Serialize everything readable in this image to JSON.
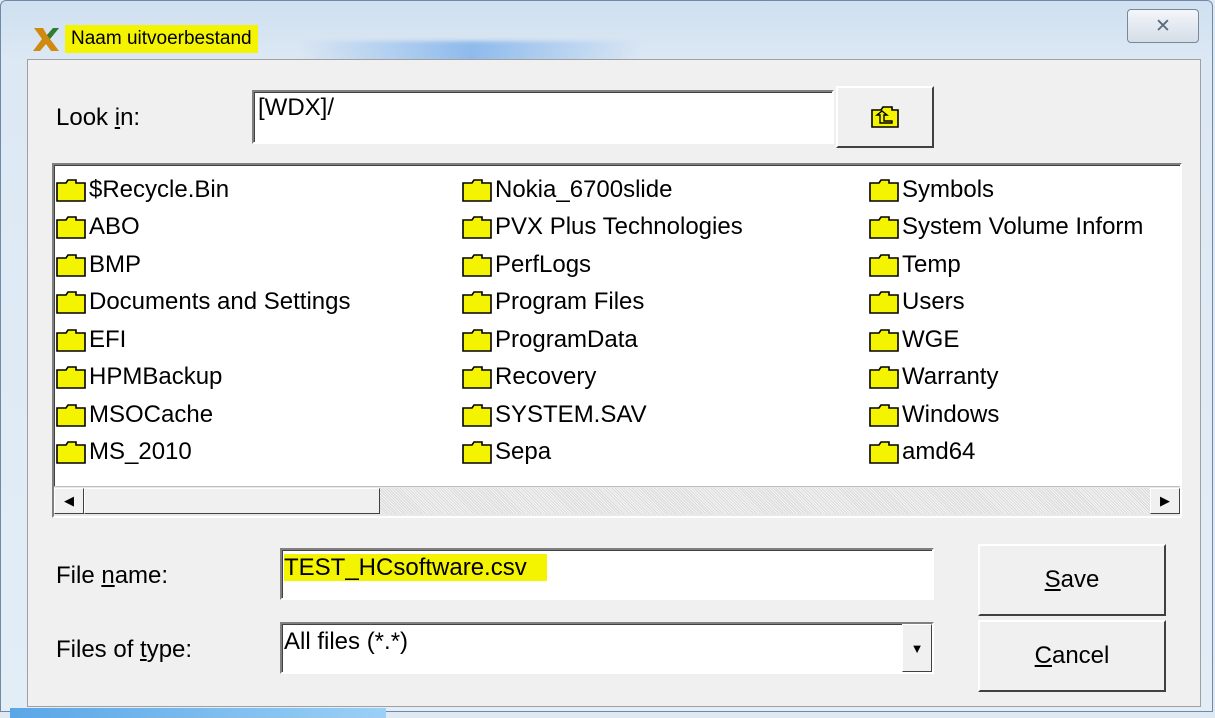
{
  "window": {
    "title": "Naam uitvoerbestand",
    "close_glyph": "✕",
    "accent_highlight": "#f4f400"
  },
  "lookin": {
    "label_pre": "Look ",
    "label_access": "i",
    "label_post": "n:",
    "value": "[WDX]/",
    "up_button_icon": "folder-up-icon"
  },
  "folders": {
    "col1": [
      "$Recycle.Bin",
      "ABO",
      "BMP",
      "Documents and Settings",
      "EFI",
      "HPMBackup",
      "MSOCache",
      "MS_2010"
    ],
    "col2": [
      "Nokia_6700slide",
      "PVX Plus Technologies",
      "PerfLogs",
      "Program Files",
      "ProgramData",
      "Recovery",
      "SYSTEM.SAV",
      "Sepa"
    ],
    "col3": [
      "Symbols",
      "System Volume Inform",
      "Temp",
      "Users",
      "WGE",
      "Warranty",
      "Windows",
      "amd64"
    ]
  },
  "filename": {
    "label_pre": "File ",
    "label_access": "n",
    "label_post": "ame:",
    "value": "TEST_HCsoftware.csv"
  },
  "filetype": {
    "label_pre": "Files of ",
    "label_access": "t",
    "label_post": "ype:",
    "value": "All files (*.*)"
  },
  "buttons": {
    "save_access": "S",
    "save_rest": "ave",
    "cancel_access": "C",
    "cancel_rest": "ancel"
  }
}
